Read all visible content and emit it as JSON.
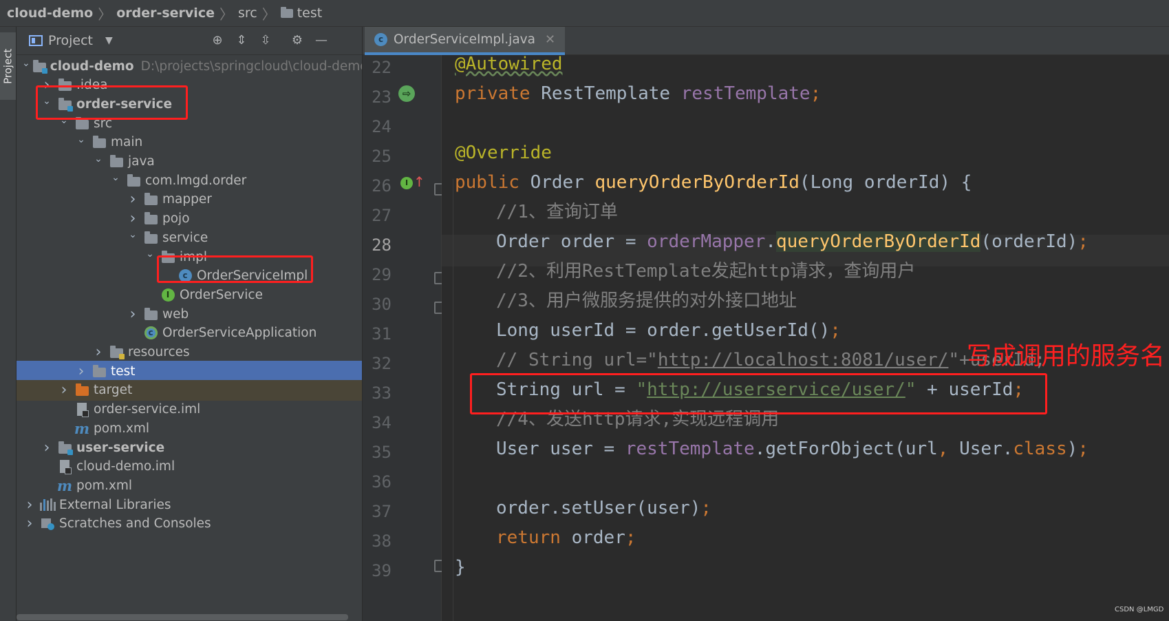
{
  "breadcrumb": {
    "items": [
      {
        "label": "cloud-demo",
        "bold": true
      },
      {
        "label": "order-service",
        "bold": true
      },
      {
        "label": "src",
        "bold": false
      },
      {
        "label": "test",
        "bold": false
      }
    ]
  },
  "tool_strip": {
    "project_tab": "Project"
  },
  "project_panel": {
    "title": "Project",
    "icons": [
      "locate-icon",
      "expand-all-icon",
      "collapse-all-icon",
      "gear-icon",
      "minimize-icon"
    ],
    "tree": [
      {
        "label": "cloud-demo",
        "path": "D:\\projects\\springcloud\\cloud-demo",
        "icon": "module-folder-icon",
        "expanded": true,
        "bold": true
      },
      {
        "label": ".idea",
        "icon": "folder-icon",
        "expanded": false
      },
      {
        "label": "order-service",
        "icon": "module-folder-icon",
        "expanded": true,
        "bold": true
      },
      {
        "label": "src",
        "icon": "folder-icon",
        "expanded": true
      },
      {
        "label": "main",
        "icon": "folder-icon",
        "expanded": true
      },
      {
        "label": "java",
        "icon": "source-folder-icon",
        "expanded": true
      },
      {
        "label": "com.lmgd.order",
        "icon": "package-icon",
        "expanded": true
      },
      {
        "label": "mapper",
        "icon": "package-icon",
        "expanded": false
      },
      {
        "label": "pojo",
        "icon": "package-icon",
        "expanded": false
      },
      {
        "label": "service",
        "icon": "package-icon",
        "expanded": true
      },
      {
        "label": "impl",
        "icon": "package-icon",
        "expanded": true
      },
      {
        "label": "OrderServiceImpl",
        "icon": "class-icon"
      },
      {
        "label": "OrderService",
        "icon": "interface-icon"
      },
      {
        "label": "web",
        "icon": "package-icon",
        "expanded": false
      },
      {
        "label": "OrderServiceApplication",
        "icon": "spring-class-icon"
      },
      {
        "label": "resources",
        "icon": "resources-folder-icon",
        "expanded": false
      },
      {
        "label": "test",
        "icon": "folder-icon",
        "expanded": false,
        "selected": true
      },
      {
        "label": "target",
        "icon": "excluded-folder-icon",
        "expanded": false
      },
      {
        "label": "order-service.iml",
        "icon": "iml-file-icon"
      },
      {
        "label": "pom.xml",
        "icon": "maven-icon"
      },
      {
        "label": "user-service",
        "icon": "module-folder-icon",
        "expanded": false,
        "bold": true
      },
      {
        "label": "cloud-demo.iml",
        "icon": "iml-file-icon"
      },
      {
        "label": "pom.xml",
        "icon": "maven-icon"
      },
      {
        "label": "External Libraries",
        "icon": "libraries-icon",
        "expanded": false
      },
      {
        "label": "Scratches and Consoles",
        "icon": "scratches-icon",
        "expanded": false
      }
    ]
  },
  "editor": {
    "tab": {
      "label": "OrderServiceImpl.java",
      "icon": "class-icon"
    },
    "current_line": 28,
    "line_numbers": [
      "22",
      "23",
      "24",
      "25",
      "26",
      "27",
      "28",
      "29",
      "30",
      "31",
      "32",
      "33",
      "34",
      "35",
      "36",
      "37",
      "38",
      "39"
    ],
    "lines": [
      [
        "@Autowired"
      ],
      [
        "private",
        " RestTemplate ",
        "restTemplate",
        ";"
      ],
      [],
      [
        "@Override"
      ],
      [
        "public",
        " Order ",
        "queryOrderByOrderId",
        "(Long orderId) {"
      ],
      [
        "//1、查询订单"
      ],
      [
        "Order order = ",
        "orderMapper",
        ".",
        "queryOrderByOrderId",
        "(orderId)",
        ";"
      ],
      [
        "//2、利用RestTemplate发起http请求，查询用户"
      ],
      [
        "//3、用户微服务提供的对外接口地址"
      ],
      [
        "Long userId = order.getUserId()",
        ";"
      ],
      [
        "// String url=\"",
        "http://localhost:8081/user/",
        "\"+userId;"
      ],
      [
        "String url = ",
        "\"",
        "http://userservice/user/",
        "\"",
        " + userId",
        ";"
      ],
      [
        "//4、发送http请求,实现远程调用"
      ],
      [
        "User user = ",
        "restTemplate",
        ".getForObject(url",
        ",",
        " User.",
        "class",
        ")",
        ";"
      ],
      [],
      [
        "order.setUser(user)",
        ";"
      ],
      [
        "return",
        " order",
        ";"
      ],
      [
        "}"
      ]
    ]
  },
  "annotation": {
    "callout": "写成调用的服务名",
    "color": "#ff2020"
  },
  "watermark": "CSDN @LMGD"
}
